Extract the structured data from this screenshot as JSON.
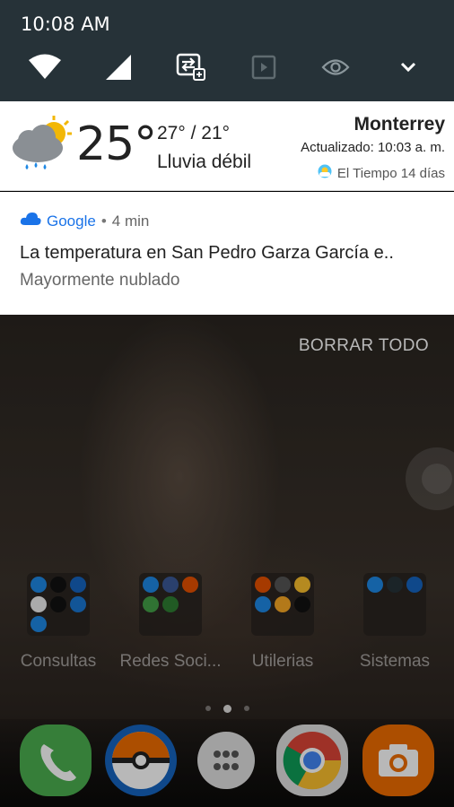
{
  "status": {
    "time": "10:08 AM"
  },
  "quick_settings": {
    "icons": [
      "wifi-icon",
      "signal-icon",
      "data-transfer-icon",
      "cast-icon",
      "eye-icon",
      "chevron-down-icon"
    ]
  },
  "weather": {
    "temp": "25°",
    "range": "27° / 21°",
    "condition": "Lluvia débil",
    "city": "Monterrey",
    "updated": "Actualizado: 10:03 a. m.",
    "source": "El Tiempo 14 días"
  },
  "notification": {
    "app": "Google",
    "separator": "•",
    "age": "4 min",
    "title": "La temperatura en San Pedro Garza García e..",
    "subtitle": "Mayormente nublado"
  },
  "home": {
    "clear_all": "BORRAR TODO",
    "folders": [
      {
        "label": "Consultas"
      },
      {
        "label": "Redes Soci..."
      },
      {
        "label": "Utilerias"
      },
      {
        "label": "Sistemas"
      }
    ],
    "dock": [
      "phone-icon",
      "pokeball-icon",
      "app-drawer-icon",
      "chrome-icon",
      "camera-icon"
    ]
  },
  "colors": {
    "accent": "#1a73e8",
    "qs_bg": "#263238"
  }
}
